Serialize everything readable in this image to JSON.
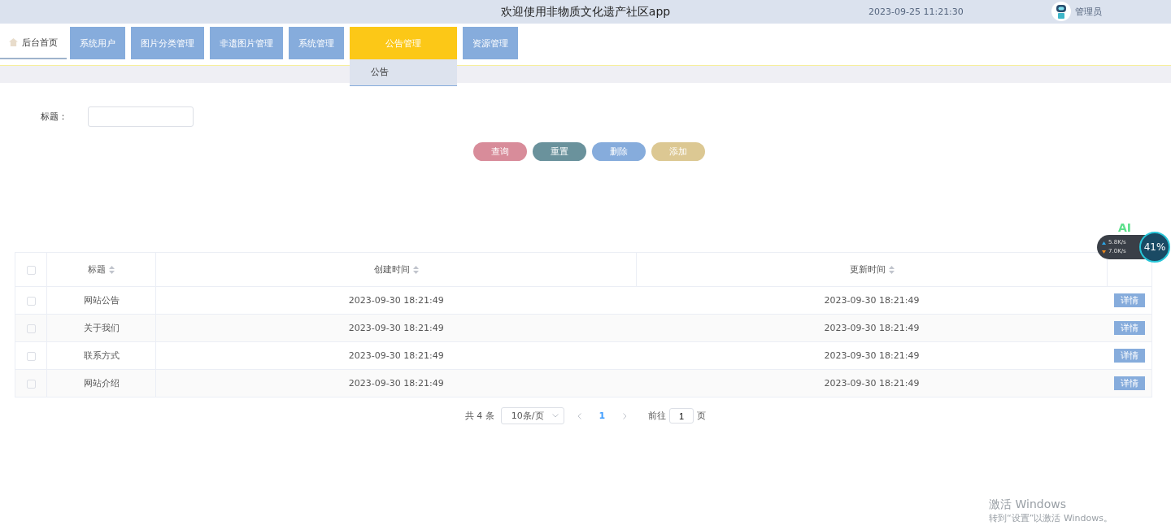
{
  "header": {
    "title": "欢迎使用非物质文化遗产社区app",
    "datetime": "2023-09-25 11:21:30",
    "user": "管理员"
  },
  "nav": [
    {
      "label": "后台首页",
      "kind": "home",
      "selected": true
    },
    {
      "label": "系统用户",
      "kind": "menu",
      "selected": false
    },
    {
      "label": "图片分类管理",
      "kind": "menu",
      "selected": false
    },
    {
      "label": "非遗图片管理",
      "kind": "menu",
      "selected": false
    },
    {
      "label": "系统管理",
      "kind": "menu",
      "selected": false
    },
    {
      "label": "公告管理",
      "kind": "menu",
      "selected": false,
      "expanded": true,
      "submenu": [
        "公告"
      ]
    },
    {
      "label": "资源管理",
      "kind": "menu",
      "selected": false
    }
  ],
  "search": {
    "label": "标题："
  },
  "buttons": [
    {
      "label": "查询",
      "color": "#d88c9a"
    },
    {
      "label": "重置",
      "color": "#6a929c"
    },
    {
      "label": "删除",
      "color": "#86acdc"
    },
    {
      "label": "添加",
      "color": "#dcc893"
    }
  ],
  "table": {
    "columns": [
      {
        "kind": "select",
        "checked": false
      },
      {
        "kind": "sortable",
        "label": "标题"
      },
      {
        "kind": "sortable",
        "label": "创建时间"
      },
      {
        "kind": "sortable",
        "label": "更新时间"
      },
      {
        "kind": "action"
      }
    ],
    "rows": [
      {
        "checked": false,
        "title": "网站公告",
        "created": "2023-09-30 18:21:49",
        "updated": "2023-09-30 18:21:49",
        "action": "详情"
      },
      {
        "checked": false,
        "title": "关于我们",
        "created": "2023-09-30 18:21:49",
        "updated": "2023-09-30 18:21:49",
        "action": "详情"
      },
      {
        "checked": false,
        "title": "联系方式",
        "created": "2023-09-30 18:21:49",
        "updated": "2023-09-30 18:21:49",
        "action": "详情"
      },
      {
        "checked": false,
        "title": "网站介绍",
        "created": "2023-09-30 18:21:49",
        "updated": "2023-09-30 18:21:49",
        "action": "详情"
      }
    ]
  },
  "pagination": {
    "total": "共 4 条",
    "page_size": "10条/页",
    "pages": [
      {
        "label": "1",
        "selected": true
      }
    ],
    "goto_label": "前往",
    "goto_value": "1",
    "goto_suffix": "页"
  },
  "net_widget": {
    "badge": "AI",
    "upload": "5.8K/s",
    "download": "7.0K/s",
    "percent": "41%"
  },
  "activation": {
    "title": "激活 Windows",
    "hint": "转到“设置”以激活 Windows。"
  }
}
